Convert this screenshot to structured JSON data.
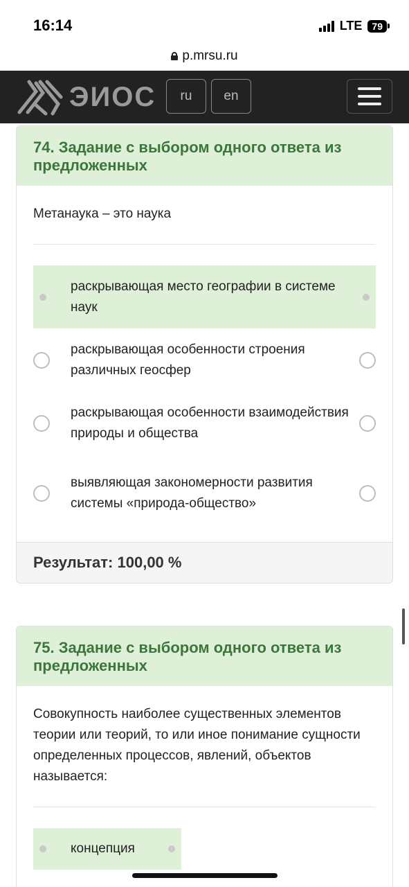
{
  "status_bar": {
    "time": "16:14",
    "network": "LTE",
    "battery": "79"
  },
  "browser": {
    "url": "p.mrsu.ru"
  },
  "navbar": {
    "brand": "ЭИОС",
    "lang_ru": "ru",
    "lang_en": "en"
  },
  "q74": {
    "title": "74. Задание с выбором одного ответа из предложенных",
    "question": "Метанаука – это наука",
    "answers": [
      {
        "text": "раскрывающая место географии в системе наук",
        "selected": true
      },
      {
        "text": "раскрывающая особенности строения различных геосфер",
        "selected": false
      },
      {
        "text": "раскрывающая особенности взаимодействия природы и общества",
        "selected": false
      },
      {
        "text": "выявляющая закономерности развития системы «природа-общество»",
        "selected": false
      }
    ],
    "result_label": "Результат:",
    "result_value": "100,00 %"
  },
  "q75": {
    "title": "75. Задание с выбором одного ответа из предложенных",
    "question": "Совокупность наиболее существенных элементов теории или теорий, то или иное понимание сущности определенных процессов, явлений, объектов называется:",
    "answers": [
      {
        "text": "концепция",
        "selected": true
      }
    ]
  },
  "colors": {
    "heading_bg": "#dff0d8",
    "heading_text": "#3c763d",
    "navbar_bg": "#222222"
  }
}
